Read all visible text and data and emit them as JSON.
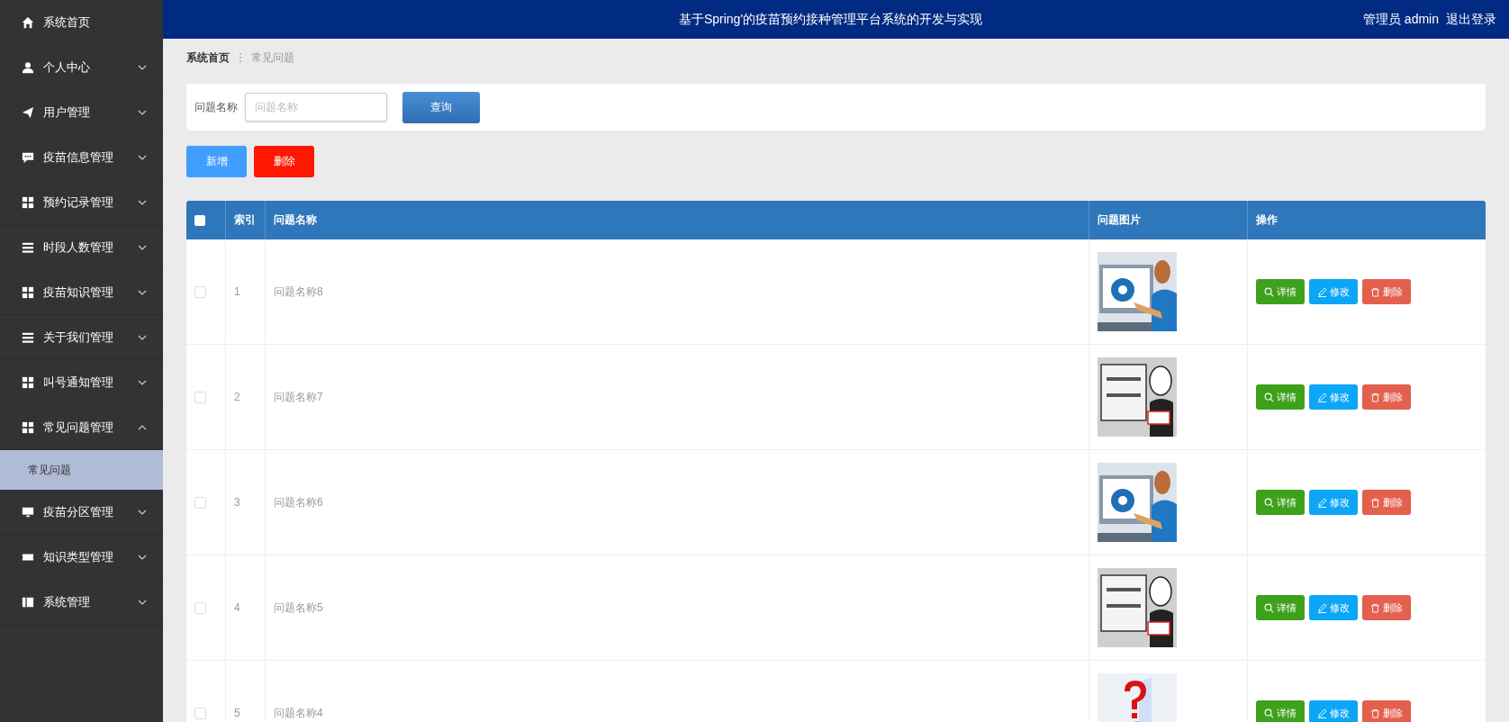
{
  "header": {
    "title": "基于Spring'的疫苗预约接种管理平台系统的开发与实现",
    "user": "管理员 admin",
    "logout": "退出登录"
  },
  "sidebar": {
    "items": [
      {
        "label": "系统首页",
        "kind": "link"
      },
      {
        "label": "个人中心",
        "kind": "menu",
        "expanded": false
      },
      {
        "label": "用户管理",
        "kind": "menu",
        "expanded": false
      },
      {
        "label": "疫苗信息管理",
        "kind": "menu",
        "expanded": false
      },
      {
        "label": "预约记录管理",
        "kind": "menu",
        "expanded": false
      },
      {
        "label": "时段人数管理",
        "kind": "menu",
        "expanded": false
      },
      {
        "label": "疫苗知识管理",
        "kind": "menu",
        "expanded": false
      },
      {
        "label": "关于我们管理",
        "kind": "menu",
        "expanded": false
      },
      {
        "label": "叫号通知管理",
        "kind": "menu",
        "expanded": false
      },
      {
        "label": "常见问题管理",
        "kind": "menu",
        "expanded": true,
        "children": [
          {
            "label": "常见问题",
            "selected": true
          }
        ]
      },
      {
        "label": "疫苗分区管理",
        "kind": "menu",
        "expanded": false
      },
      {
        "label": "知识类型管理",
        "kind": "menu",
        "expanded": false
      },
      {
        "label": "系统管理",
        "kind": "menu",
        "expanded": false
      }
    ]
  },
  "breadcrumb": [
    "系统首页",
    "常见问题"
  ],
  "search": {
    "label": "问题名称",
    "placeholder": "问题名称",
    "button": "查询"
  },
  "actions": [
    "新增",
    "删除"
  ],
  "table": {
    "select_all": {
      "checked": false
    },
    "columns": [
      "索引",
      "问题名称",
      "问题图片",
      "操作"
    ],
    "rows": [
      {
        "checked": false,
        "index": "1",
        "name": "问题名称8",
        "image": {
          "kind": "picture"
        },
        "actions": [
          "详情",
          "修改",
          "删除"
        ]
      },
      {
        "checked": false,
        "index": "2",
        "name": "问题名称7",
        "image": {
          "kind": "picture"
        },
        "actions": [
          "详情",
          "修改",
          "删除"
        ]
      },
      {
        "checked": false,
        "index": "3",
        "name": "问题名称6",
        "image": {
          "kind": "picture"
        },
        "actions": [
          "详情",
          "修改",
          "删除"
        ]
      },
      {
        "checked": false,
        "index": "4",
        "name": "问题名称5",
        "image": {
          "kind": "picture"
        },
        "actions": [
          "详情",
          "修改",
          "删除"
        ]
      },
      {
        "checked": false,
        "index": "5",
        "name": "问题名称4",
        "image": {
          "kind": "picture"
        },
        "actions": [
          "详情",
          "修改",
          "删除"
        ]
      }
    ]
  }
}
